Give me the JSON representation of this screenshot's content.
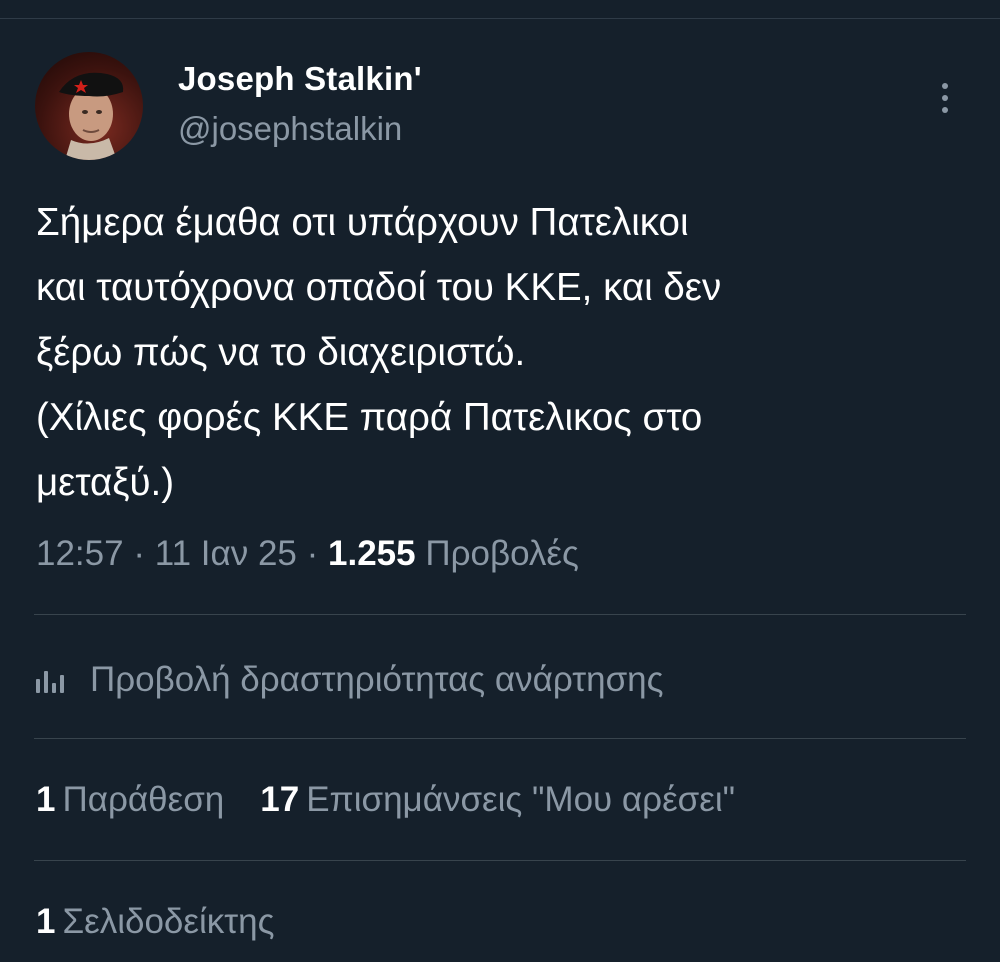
{
  "author": {
    "display_name": "Joseph Stalkin'",
    "handle": "@josephstalkin"
  },
  "tweet": {
    "text": "Σήμερα έμαθα οτι υπάρχουν Πατελικοι\nκαι ταυτόχρονα οπαδοί του ΚΚΕ, και δεν\nξέρω πώς να το διαχειριστώ.\n(Χίλιες φορές ΚΚΕ παρά Πατελικος στο\nμεταξύ.)",
    "time": "12:57",
    "separator": "·",
    "date": "11 Ιαν 25",
    "views_count": "1.255",
    "views_label": "Προβολές"
  },
  "activity": {
    "icon": "analytics-icon",
    "label": "Προβολή δραστηριότητας ανάρτησης"
  },
  "stats": {
    "quotes_count": "1",
    "quotes_label": "Παράθεση",
    "likes_count": "17",
    "likes_label": "Επισημάνσεις \"Μου αρέσει\"",
    "bookmarks_count": "1",
    "bookmarks_label": "Σελιδοδείκτης"
  },
  "colors": {
    "background": "#15202b",
    "primary_text": "#ffffff",
    "secondary_text": "#8b98a5",
    "divider": "#38444d"
  }
}
